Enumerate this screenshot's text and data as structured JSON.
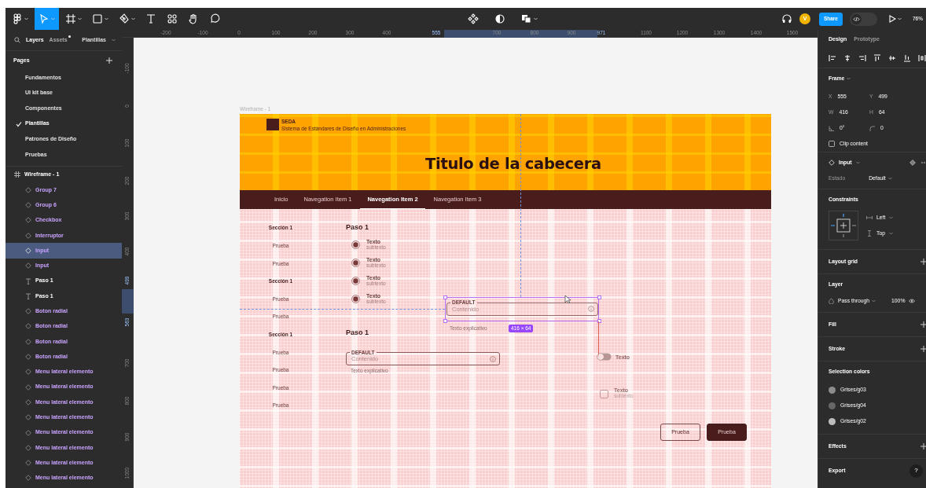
{
  "toolbar": {
    "tools": [
      {
        "kind": "menu",
        "selected": false
      },
      {
        "kind": "move",
        "selected": true
      },
      {
        "kind": "frame",
        "selected": false
      },
      {
        "kind": "shape",
        "selected": false
      },
      {
        "kind": "pen",
        "selected": false
      },
      {
        "kind": "text",
        "selected": false
      },
      {
        "kind": "resources",
        "selected": false
      },
      {
        "kind": "hand",
        "selected": false
      },
      {
        "kind": "comment",
        "selected": false
      }
    ],
    "center_tools": [
      {
        "kind": "component"
      },
      {
        "kind": "mask"
      },
      {
        "kind": "boolean"
      }
    ],
    "avatar": "V",
    "share": "Share",
    "code_mode": false,
    "zoom": "76%"
  },
  "left_panel": {
    "tabs": [
      {
        "label": "Layers",
        "selected": true,
        "dot": false
      },
      {
        "label": "Assets",
        "selected": false,
        "dot": true
      }
    ],
    "library": "Plantillas",
    "pages_title": "Pages",
    "pages": [
      {
        "name": "Fundamentos",
        "selected": false
      },
      {
        "name": "UI kit base",
        "selected": false
      },
      {
        "name": "Componentes",
        "selected": false
      },
      {
        "name": "Plantillas",
        "selected": true
      },
      {
        "name": "Patrones de Diseño",
        "selected": false
      },
      {
        "name": "Pruebas",
        "selected": false
      }
    ],
    "layers": {
      "name": "Wireframe - 1",
      "children": [
        {
          "name": "Group 7",
          "kind": "component",
          "selected": false
        },
        {
          "name": "Group 6",
          "kind": "component",
          "selected": false
        },
        {
          "name": "Checkbox",
          "kind": "component",
          "selected": false
        },
        {
          "name": "Interruptor",
          "kind": "component",
          "selected": false
        },
        {
          "name": "Input",
          "kind": "component",
          "selected": true
        },
        {
          "name": "Input",
          "kind": "component",
          "selected": false
        },
        {
          "name": "Paso 1",
          "kind": "text",
          "selected": false
        },
        {
          "name": "Paso 1",
          "kind": "text",
          "selected": false
        },
        {
          "name": "Boton radial",
          "kind": "component",
          "selected": false
        },
        {
          "name": "Boton radial",
          "kind": "component",
          "selected": false
        },
        {
          "name": "Boton radial",
          "kind": "component",
          "selected": false
        },
        {
          "name": "Boton radial",
          "kind": "component",
          "selected": false
        },
        {
          "name": "Menu lateral elemento",
          "kind": "component",
          "selected": false
        },
        {
          "name": "Menu lateral elemento",
          "kind": "component",
          "selected": false
        },
        {
          "name": "Menu lateral elemento",
          "kind": "component",
          "selected": false
        },
        {
          "name": "Menu lateral elemento",
          "kind": "component",
          "selected": false
        },
        {
          "name": "Menu lateral elemento",
          "kind": "component",
          "selected": false
        },
        {
          "name": "Menu lateral elemento",
          "kind": "component",
          "selected": false
        },
        {
          "name": "Menu lateral elemento",
          "kind": "component",
          "selected": false
        },
        {
          "name": "Menu lateral elemento",
          "kind": "component",
          "selected": false
        }
      ]
    }
  },
  "canvas": {
    "h_ruler": [
      {
        "text": "-200",
        "selected": false
      },
      {
        "text": "-100",
        "selected": false
      },
      {
        "text": "0",
        "selected": false
      },
      {
        "text": "100",
        "selected": false
      },
      {
        "text": "200",
        "selected": false
      },
      {
        "text": "300",
        "selected": false
      },
      {
        "text": "400",
        "selected": false
      },
      {
        "text": "555",
        "selected": true
      },
      {
        "text": "700",
        "selected": false
      },
      {
        "text": "800",
        "selected": false
      },
      {
        "text": "900",
        "selected": false
      },
      {
        "text": "971",
        "selected": true
      },
      {
        "text": "1100",
        "selected": false
      },
      {
        "text": "1200",
        "selected": false
      },
      {
        "text": "1300",
        "selected": false
      },
      {
        "text": "1400",
        "selected": false
      },
      {
        "text": "1500",
        "selected": false
      }
    ],
    "v_ruler": [
      {
        "text": "-100",
        "selected": false
      },
      {
        "text": "0",
        "selected": false
      },
      {
        "text": "100",
        "selected": false
      },
      {
        "text": "200",
        "selected": false
      },
      {
        "text": "300",
        "selected": false
      },
      {
        "text": "400",
        "selected": false
      },
      {
        "text": "499",
        "selected": true
      },
      {
        "text": "563",
        "selected": true
      },
      {
        "text": "700",
        "selected": false
      },
      {
        "text": "800",
        "selected": false
      },
      {
        "text": "900",
        "selected": false
      },
      {
        "text": "1000",
        "selected": false
      }
    ],
    "frame_label": "Wireframe - 1",
    "frame": {
      "logo": {
        "name": "SEDA",
        "subtitle": "Sistema de Estándares de Diseño en Administraciones"
      },
      "title": "Titulo de la cabecera",
      "nav": [
        {
          "label": "Inicio",
          "selected": false
        },
        {
          "label": "Navegation Item 1",
          "selected": false
        },
        {
          "label": "Navegation Item 2",
          "selected": true
        },
        {
          "label": "Navegation Item 3",
          "selected": false
        }
      ],
      "side_menu": [
        {
          "kind": "section",
          "label": "Sección 1"
        },
        {
          "kind": "item",
          "label": "Prueba"
        },
        {
          "kind": "item",
          "label": "Prueba"
        },
        {
          "kind": "section",
          "label": "Sección 1"
        },
        {
          "kind": "item",
          "label": "Prueba"
        },
        {
          "kind": "item",
          "label": "Prueba"
        },
        {
          "kind": "section",
          "label": "Sección 1"
        },
        {
          "kind": "item",
          "label": "Prueba"
        },
        {
          "kind": "item",
          "label": "Prueba"
        },
        {
          "kind": "item",
          "label": "Prueba"
        },
        {
          "kind": "item",
          "label": "Prueba"
        }
      ],
      "steps": [
        {
          "title": "Paso 1",
          "radios": [
            {
              "label": "Texto",
              "sublabel": "subtexto",
              "checked": true
            },
            {
              "label": "Texto",
              "sublabel": "subtexto",
              "checked": true
            },
            {
              "label": "Texto",
              "sublabel": "subtexto",
              "checked": true
            },
            {
              "label": "Texto",
              "sublabel": "subtexto",
              "checked": true
            }
          ]
        },
        {
          "title": "Paso 1",
          "input": {
            "label": "DEFAULT",
            "placeholder": "Contenido",
            "help": "Texto explicativo"
          }
        }
      ],
      "selected_input": {
        "label": "DEFAULT",
        "placeholder": "Contenido",
        "help": "Texto explicativo",
        "size": "416 × 64"
      },
      "toggle": {
        "label": "Texto",
        "on": false
      },
      "checkbox": {
        "label": "Texto",
        "sublabel": "subtexto",
        "checked": false
      },
      "buttons": [
        {
          "label": "Prueba",
          "kind": "outline"
        },
        {
          "label": "Prueba",
          "kind": "filled"
        }
      ]
    }
  },
  "right_panel": {
    "tabs": [
      {
        "label": "Design",
        "selected": true
      },
      {
        "label": "Prototype",
        "selected": false
      }
    ],
    "frame": {
      "title": "Frame",
      "fields": [
        {
          "kind": "text",
          "label": "X",
          "value": "555"
        },
        {
          "kind": "text",
          "label": "Y",
          "value": "499"
        },
        {
          "kind": "text",
          "label": "W",
          "value": "416"
        },
        {
          "kind": "text",
          "label": "H",
          "value": "64"
        },
        {
          "kind": "rotation",
          "value": "0°"
        },
        {
          "kind": "radius",
          "value": "0"
        }
      ],
      "clip_content": {
        "label": "Clip content",
        "checked": false
      }
    },
    "instance": {
      "name": "Input",
      "property": "Estado",
      "value": "Default"
    },
    "constraints": {
      "title": "Constraints",
      "horizontal": "Left",
      "vertical": "Top"
    },
    "layout_grid": "Layout grid",
    "layer": {
      "title": "Layer",
      "blend": "Pass through",
      "opacity": "100%"
    },
    "fill": "Fill",
    "stroke": "Stroke",
    "selection_colors": {
      "title": "Selection colors",
      "colors": [
        {
          "name": "Grises/g03",
          "color": "#8c8c8c"
        },
        {
          "name": "Grises/g04",
          "color": "#676767"
        },
        {
          "name": "Grises/g02",
          "color": "#bdbdbd"
        }
      ]
    },
    "effects": "Effects",
    "export": "Export",
    "help": "?"
  }
}
